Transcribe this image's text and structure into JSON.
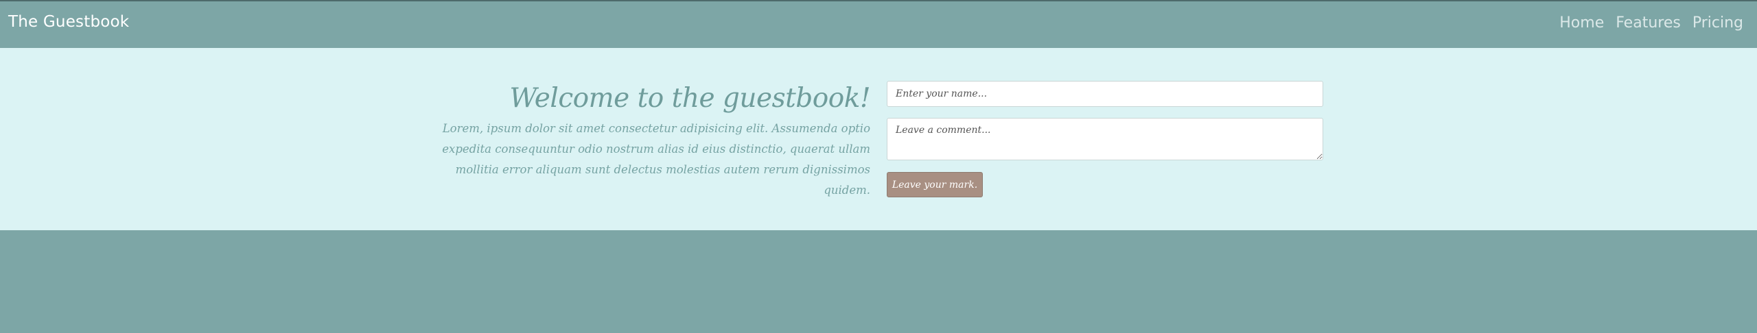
{
  "navbar": {
    "brand": "The Guestbook",
    "links": [
      {
        "label": "Home"
      },
      {
        "label": "Features"
      },
      {
        "label": "Pricing"
      }
    ]
  },
  "hero": {
    "title": "Welcome to the guestbook!",
    "lead": "Lorem, ipsum dolor sit amet consectetur adipisicing elit. Assumenda optio expedita consequuntur odio nostrum alias id eius distinctio, quaerat ullam mollitia error aliquam sunt delectus molestias autem rerum dignissimos quidem."
  },
  "form": {
    "name_placeholder": "Enter your name...",
    "name_value": "",
    "comment_placeholder": "Leave a comment...",
    "comment_value": "",
    "submit_label": "Leave your mark."
  },
  "colors": {
    "navbar": "#7da6a6",
    "hero_background": "#dbf3f4",
    "title_text": "#6f9c9b",
    "button": "#a88f82"
  }
}
